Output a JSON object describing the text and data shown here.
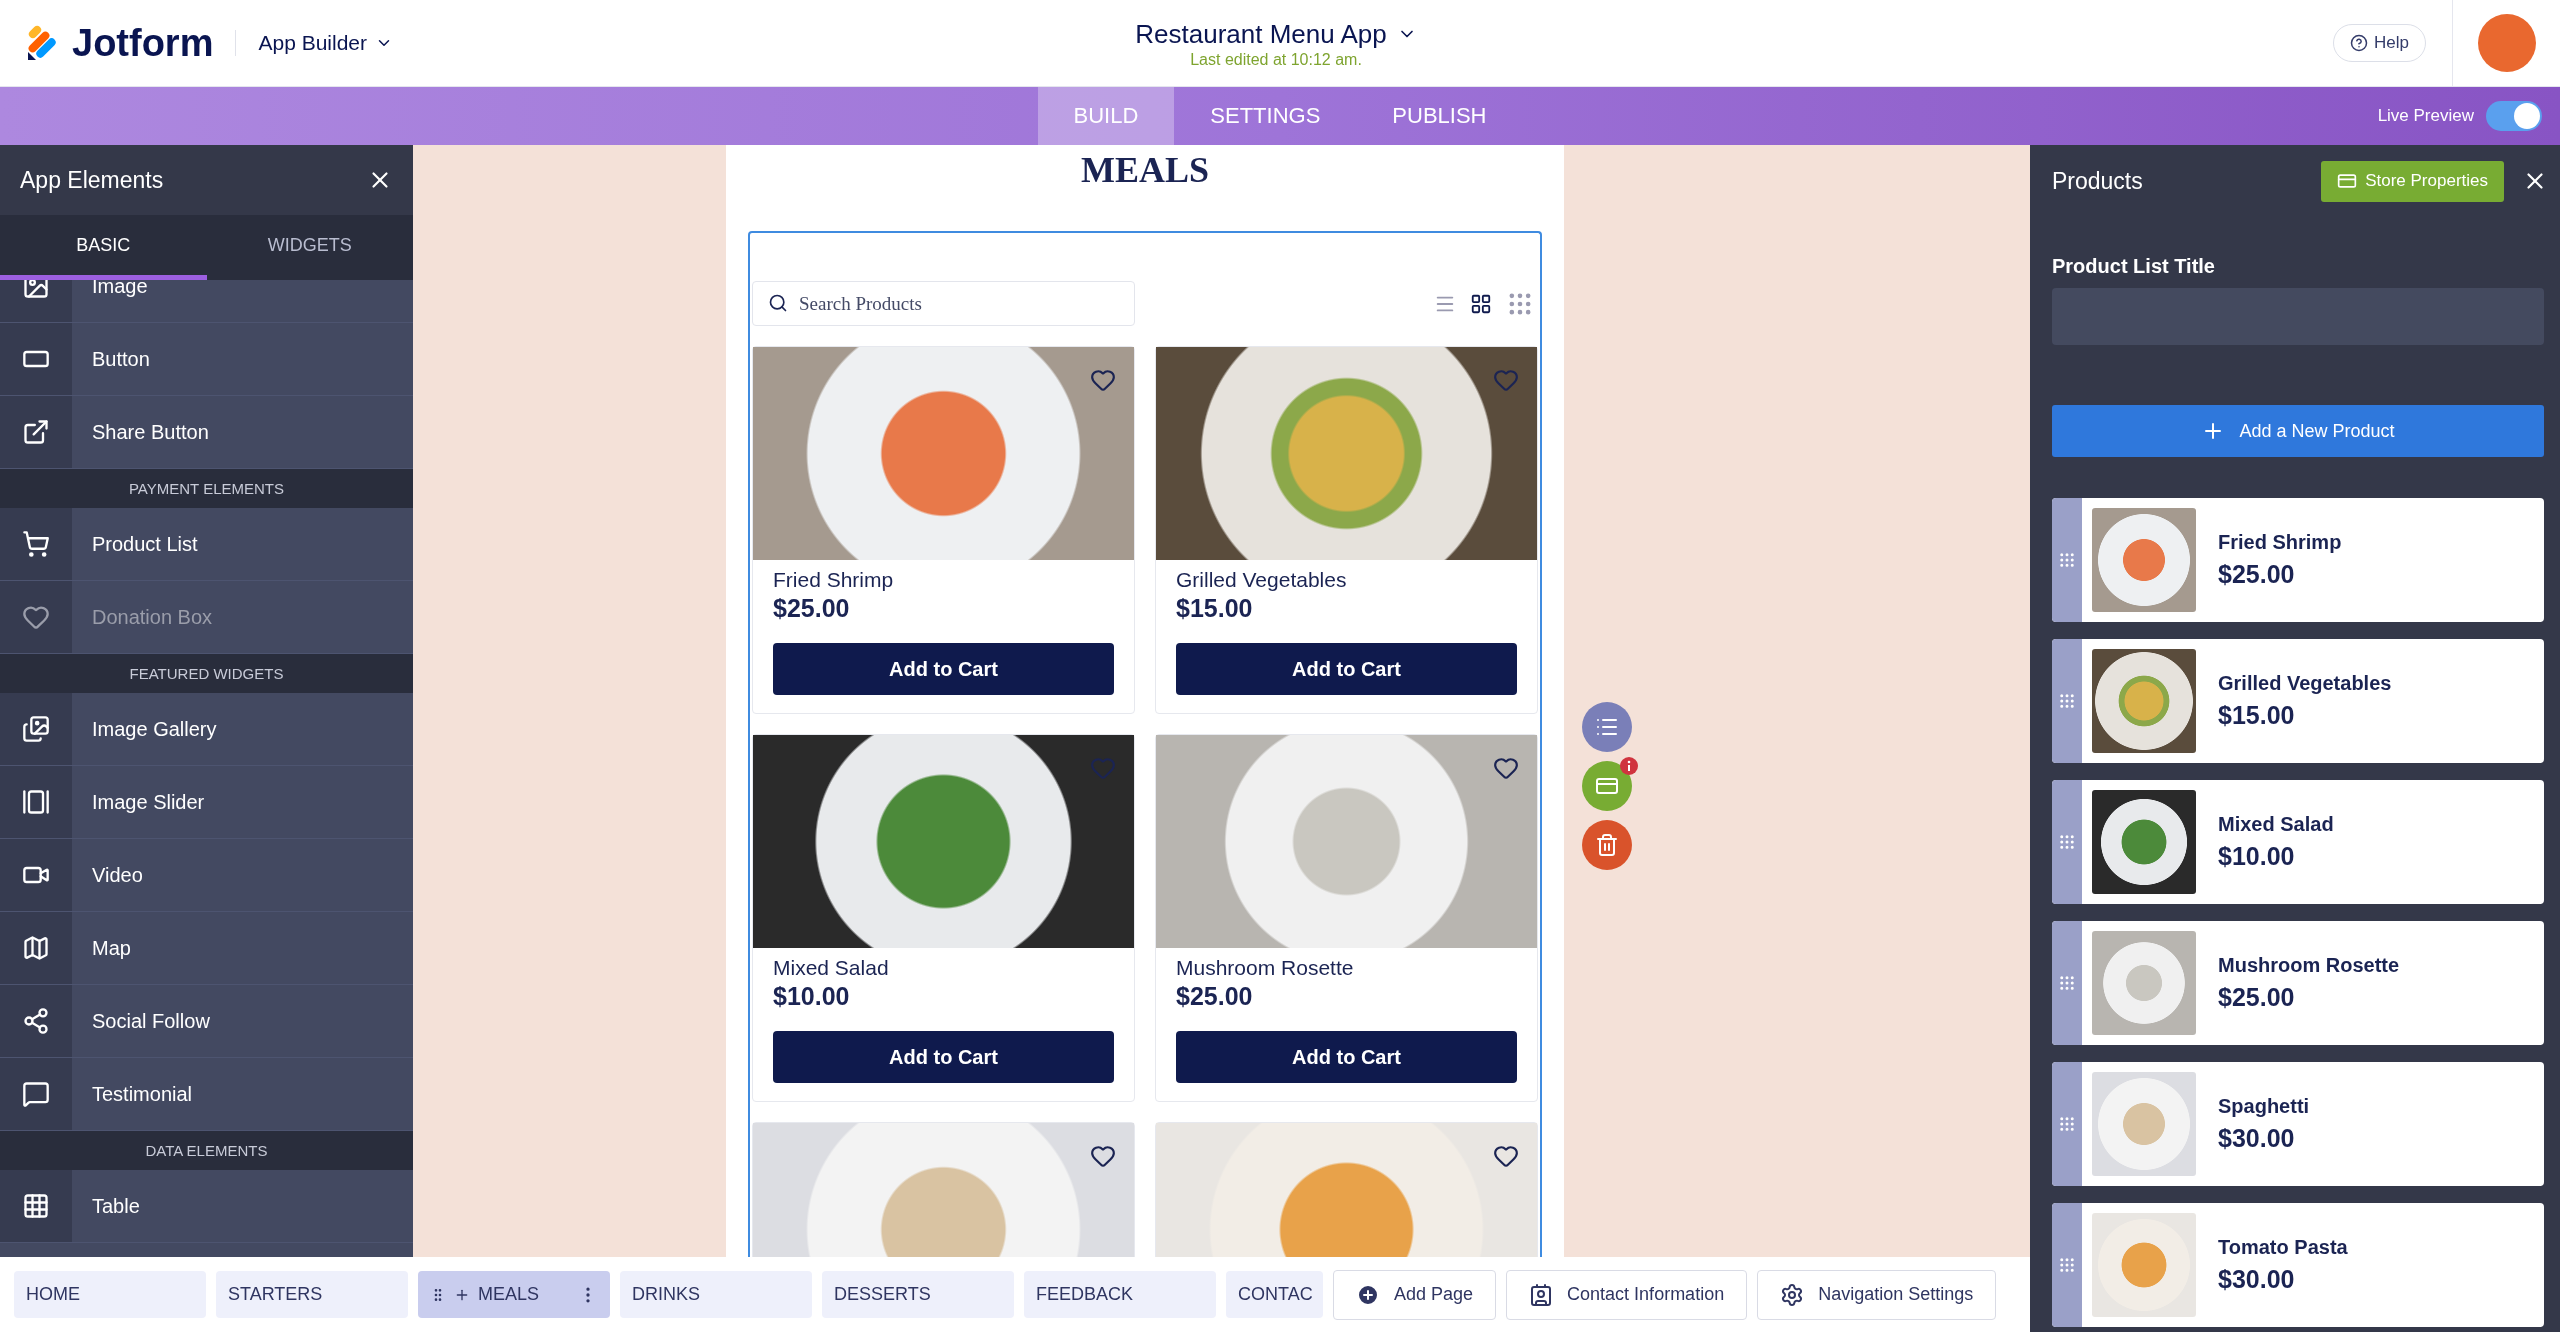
{
  "header": {
    "logo": "Jotform",
    "builder_menu": "App Builder",
    "app_title": "Restaurant Menu App",
    "last_edited": "Last edited at 10:12 am.",
    "help": "Help"
  },
  "nav_tabs": [
    {
      "label": "BUILD",
      "selected": true
    },
    {
      "label": "SETTINGS",
      "selected": false
    },
    {
      "label": "PUBLISH",
      "selected": false
    }
  ],
  "live_preview": {
    "label": "Live Preview",
    "on": true
  },
  "elements_panel": {
    "title": "App Elements",
    "tabs": [
      {
        "label": "BASIC",
        "selected": true
      },
      {
        "label": "WIDGETS",
        "selected": false
      }
    ],
    "items": [
      {
        "kind": "item",
        "label": "Image",
        "disabled": false
      },
      {
        "kind": "item",
        "label": "Button",
        "disabled": false
      },
      {
        "kind": "item",
        "label": "Share Button",
        "disabled": false
      },
      {
        "kind": "heading",
        "label": "PAYMENT ELEMENTS"
      },
      {
        "kind": "item",
        "label": "Product List",
        "disabled": false
      },
      {
        "kind": "item",
        "label": "Donation Box",
        "disabled": true
      },
      {
        "kind": "heading",
        "label": "FEATURED WIDGETS"
      },
      {
        "kind": "item",
        "label": "Image Gallery",
        "disabled": false
      },
      {
        "kind": "item",
        "label": "Image Slider",
        "disabled": false
      },
      {
        "kind": "item",
        "label": "Video",
        "disabled": false
      },
      {
        "kind": "item",
        "label": "Map",
        "disabled": false
      },
      {
        "kind": "item",
        "label": "Social Follow",
        "disabled": false
      },
      {
        "kind": "item",
        "label": "Testimonial",
        "disabled": false
      },
      {
        "kind": "heading",
        "label": "DATA ELEMENTS"
      },
      {
        "kind": "item",
        "label": "Table",
        "disabled": false
      }
    ]
  },
  "canvas": {
    "page_title": "MEALS",
    "search": {
      "placeholder": "Search Products"
    },
    "view_modes": [
      {
        "selected": false
      },
      {
        "selected": true
      },
      {
        "selected": false
      }
    ],
    "products": [
      {
        "name": "Fried Shrimp",
        "price": "$25.00",
        "button": "Add to Cart"
      },
      {
        "name": "Grilled Vegetables",
        "price": "$15.00",
        "button": "Add to Cart"
      },
      {
        "name": "Mixed Salad",
        "price": "$10.00",
        "button": "Add to Cart"
      },
      {
        "name": "Mushroom Rosette",
        "price": "$25.00",
        "button": "Add to Cart"
      }
    ]
  },
  "products_panel": {
    "title": "Products",
    "store_properties": "Store Properties",
    "field_label": "Product List Title",
    "add_button": "Add a New Product",
    "products": [
      {
        "name": "Fried Shrimp",
        "price": "$25.00"
      },
      {
        "name": "Grilled Vegetables",
        "price": "$15.00"
      },
      {
        "name": "Mixed Salad",
        "price": "$10.00"
      },
      {
        "name": "Mushroom Rosette",
        "price": "$25.00"
      },
      {
        "name": "Spaghetti",
        "price": "$30.00"
      },
      {
        "name": "Tomato Pasta",
        "price": "$30.00"
      }
    ]
  },
  "page_tabs": [
    {
      "label": "HOME",
      "selected": false
    },
    {
      "label": "STARTERS",
      "selected": false
    },
    {
      "label": "MEALS",
      "selected": true
    },
    {
      "label": "DRINKS",
      "selected": false
    },
    {
      "label": "DESSERTS",
      "selected": false
    },
    {
      "label": "FEEDBACK",
      "selected": false
    },
    {
      "label": "CONTAC",
      "selected": false
    }
  ],
  "bottom_buttons": {
    "add_page": "Add Page",
    "contact": "Contact Information",
    "navigation": "Navigation Settings"
  }
}
